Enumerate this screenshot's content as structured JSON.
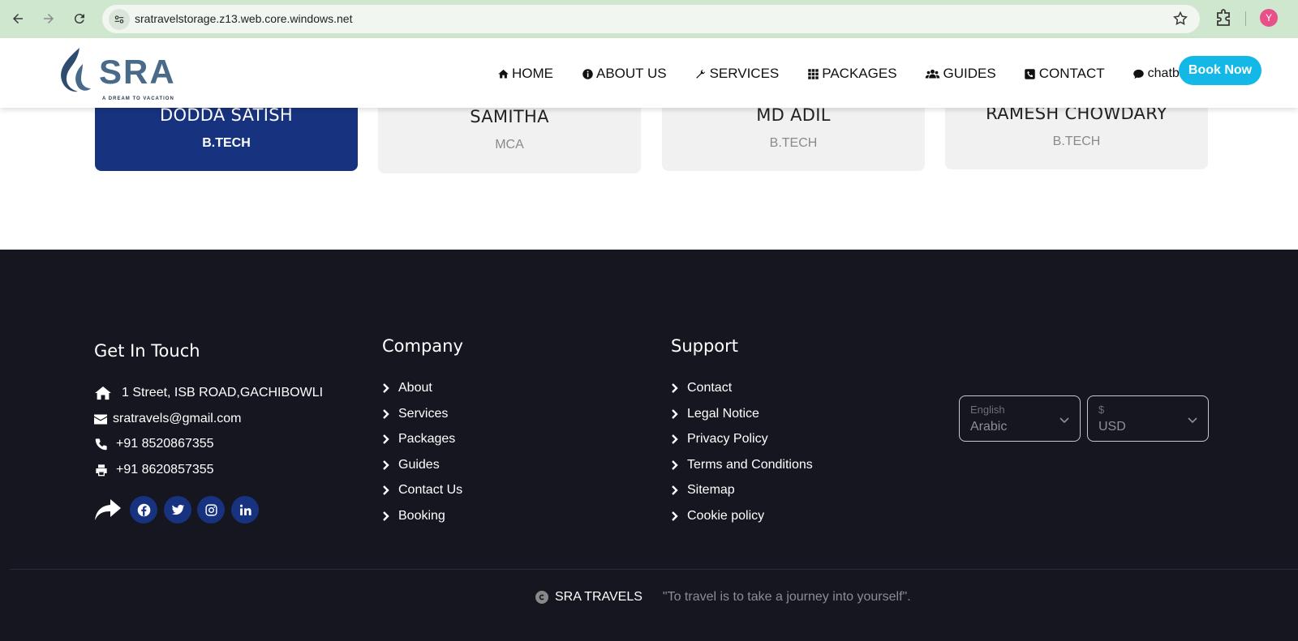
{
  "browser": {
    "url": "sratravelstorage.z13.web.core.windows.net",
    "profile_initial": "Y"
  },
  "brand": {
    "name": "SRA",
    "tagline": "A DREAM TO VACATION"
  },
  "nav": {
    "items": [
      {
        "label": "HOME",
        "icon": "home-icon"
      },
      {
        "label": "ABOUT US",
        "icon": "info-icon"
      },
      {
        "label": "SERVICES",
        "icon": "wrench-icon"
      },
      {
        "label": "PACKAGES",
        "icon": "grid-icon"
      },
      {
        "label": "GUIDES",
        "icon": "users-icon"
      },
      {
        "label": "CONTACT",
        "icon": "phone-square-icon"
      },
      {
        "label": "chatbot",
        "icon": "comment-icon"
      }
    ],
    "book_now": "Book Now"
  },
  "guides": [
    {
      "name": "DODDA SATISH",
      "degree": "B.TECH"
    },
    {
      "name": "SAMITHA",
      "degree": "MCA"
    },
    {
      "name": "MD ADIL",
      "degree": "B.TECH"
    },
    {
      "name": "RAMESH CHOWDARY",
      "degree": "B.TECH"
    }
  ],
  "footer": {
    "get_in_touch": {
      "title": "Get In Touch",
      "address": "1 Street, ISB ROAD,GACHIBOWLI",
      "email": "sratravels@gmail.com",
      "phone": "+91 8520867355",
      "fax": "+91 8620857355"
    },
    "company": {
      "title": "Company",
      "links": [
        "About",
        "Services",
        "Packages",
        "Guides",
        "Contact Us",
        "Booking"
      ]
    },
    "support": {
      "title": "Support",
      "links": [
        "Contact",
        "Legal Notice",
        "Privacy Policy",
        "Terms and Conditions",
        "Sitemap",
        "Cookie policy"
      ]
    },
    "language_select": {
      "label": "English",
      "value": "Arabic"
    },
    "currency_select": {
      "label": "$",
      "value": "USD"
    },
    "copyright_brand": "SRA TRAVELS",
    "quote": "\"To travel is to take a journey into yourself\"."
  },
  "colors": {
    "accent": "#14b8e6",
    "card_active": "#17327e",
    "footer_bg": "#161620"
  }
}
